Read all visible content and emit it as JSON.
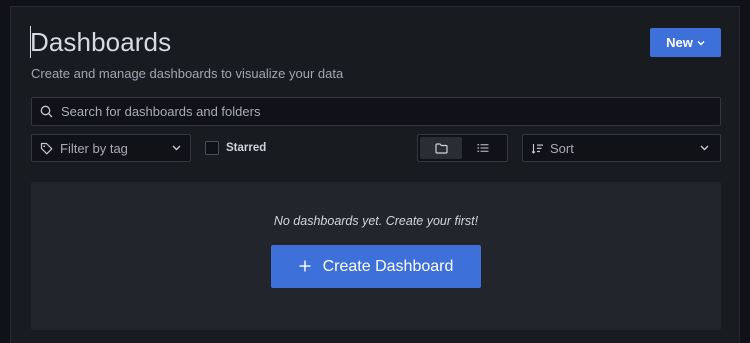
{
  "page": {
    "title": "Dashboards",
    "subtitle": "Create and manage dashboards to visualize your data"
  },
  "header": {
    "new_button_label": "New",
    "new_button_icon": "chevron-down-icon"
  },
  "search": {
    "placeholder": "Search for dashboards and folders",
    "icon": "search-icon"
  },
  "filters": {
    "tag_filter_placeholder": "Filter by tag",
    "tag_icon": "tag-icon",
    "starred_label": "Starred",
    "starred_checked": false,
    "view_modes": [
      {
        "name": "folder-view",
        "icon": "folder-icon",
        "active": true
      },
      {
        "name": "list-view",
        "icon": "list-icon",
        "active": false
      }
    ],
    "sort_placeholder": "Sort",
    "sort_icon": "sort-icon"
  },
  "empty_state": {
    "message": "No dashboards yet. Create your first!",
    "create_button_label": "Create Dashboard",
    "create_button_icon": "plus-icon"
  },
  "colors": {
    "primary": "#3d71d9",
    "background": "#181b1f",
    "panel": "#22252b"
  }
}
